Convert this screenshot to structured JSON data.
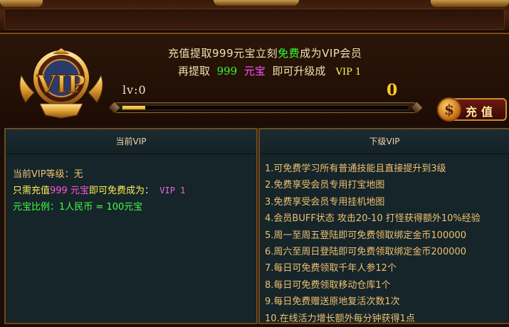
{
  "header": {
    "line1_prefix": "充值提取999元宝立刻",
    "line1_free": "免费",
    "line1_suffix": "成为VIP会员",
    "line2_prefix": "再提取",
    "line2_amount": "999",
    "line2_currency": "元宝",
    "line2_middle": "即可升级成",
    "line2_target": "VIP 1",
    "level_label": "lv:0",
    "level_value": "0",
    "progress_fraction": 0.08,
    "vip_badge_text": "VIP",
    "recharge_button": "充值",
    "recharge_coin_symbol": "$"
  },
  "left_panel": {
    "title": "当前VIP",
    "current_level_label": "当前VIP等级：",
    "current_level_value": "无",
    "need_prefix": "只需充值",
    "need_amount": "999 元宝",
    "need_middle": "即可免费成为：",
    "need_target": "VIP 1",
    "ratio_label": "元宝比例：",
    "ratio_value": "1人民币 = 100元宝"
  },
  "right_panel": {
    "title": "下级VIP",
    "items": [
      "1.可免费学习所有普通技能且直接提升到3级",
      "2.免费享受会员专用打宝地图",
      "3.免费享受会员专用挂机地图",
      "4.会员BUFF状态  攻击20-10 打怪获得额外10%经验",
      "5.周一至周五登陆即可免费领取绑定金币100000",
      "6.周六至周日登陆即可免费领取绑定金币200000",
      "7.每日可免费领取千年人参12个",
      "8.每日可免费领取移动仓库1个",
      "9.每日免费赠送原地复活次数1次",
      "10.在线活力增长额外每分钟获得1点"
    ]
  },
  "colors": {
    "accent_gold": "#ffcc22",
    "green": "#33ff33",
    "magenta": "#ff55ff",
    "panel_bg": "#15252a",
    "border": "#6a4a26"
  }
}
